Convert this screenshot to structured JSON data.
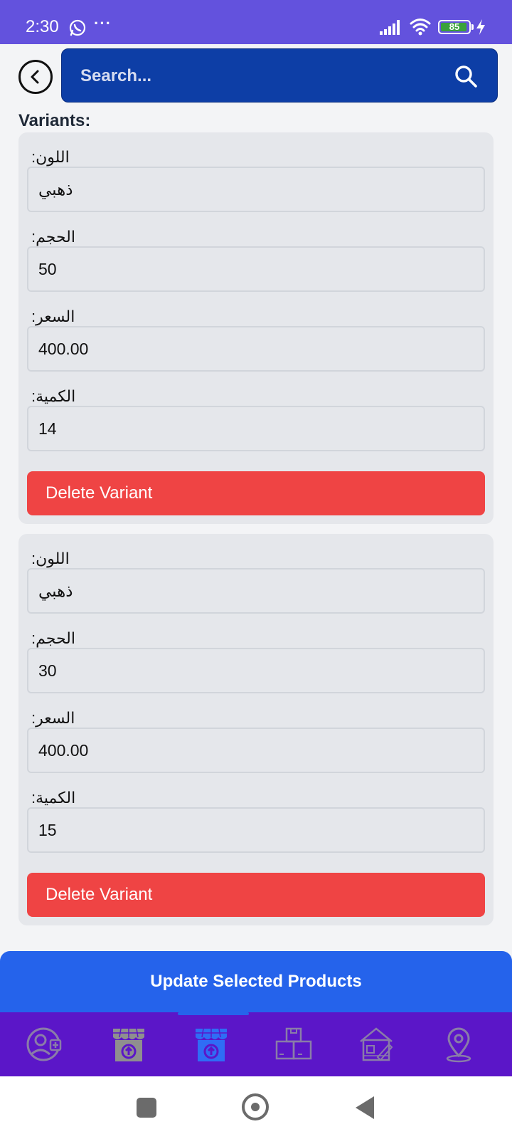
{
  "status_bar": {
    "time": "2:30",
    "more": "···",
    "battery": "85"
  },
  "header": {
    "search_placeholder": "Search..."
  },
  "variants_title": "Variants:",
  "variants": [
    {
      "color_label": "اللون:",
      "color_value": "ذهبي",
      "size_label": "الحجم:",
      "size_value": "50",
      "price_label": "السعر:",
      "price_value": "400.00",
      "qty_label": "الكمية:",
      "qty_value": "14",
      "delete_label": "Delete Variant"
    },
    {
      "color_label": "اللون:",
      "color_value": "ذهبي",
      "size_label": "الحجم:",
      "size_value": "30",
      "price_label": "السعر:",
      "price_value": "400.00",
      "qty_label": "الكمية:",
      "qty_value": "15",
      "delete_label": "Delete Variant"
    }
  ],
  "update_button": "Update Selected Products",
  "bottom_nav": {
    "items": [
      {
        "icon": "add-user-icon",
        "active": false
      },
      {
        "icon": "store-upload-icon",
        "active": false
      },
      {
        "icon": "store-upload-icon",
        "active": true
      },
      {
        "icon": "boxes-icon",
        "active": false
      },
      {
        "icon": "house-plan-icon",
        "active": false
      },
      {
        "icon": "location-pin-icon",
        "active": false
      }
    ]
  },
  "colors": {
    "status_bar": "#6352dd",
    "search_bg": "#0d3ea6",
    "delete": "#ef4444",
    "update": "#2563eb",
    "bottom_nav": "#5b16c8",
    "nav_active": "#2f6df5"
  }
}
